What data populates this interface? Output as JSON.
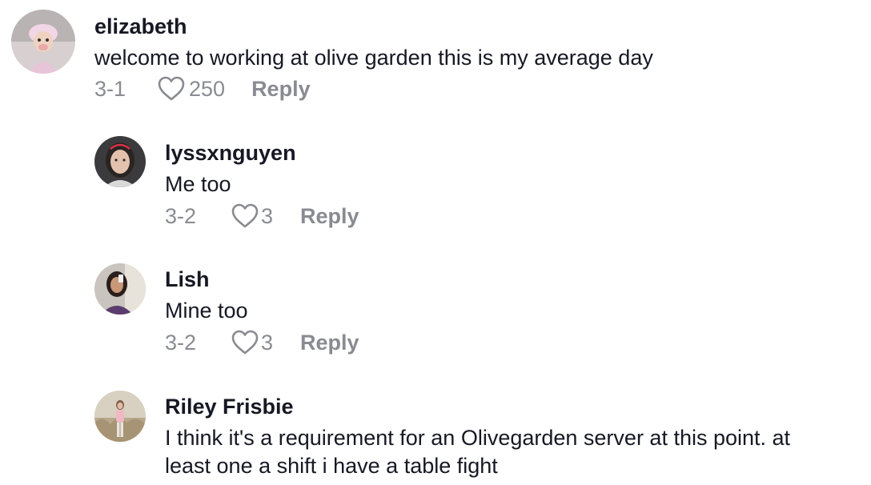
{
  "comments": [
    {
      "username": "elizabeth",
      "text_lines": [
        "welcome to working at olive garden this is my average day"
      ],
      "date": "3-1",
      "likes": "250",
      "reply_label": "Reply"
    },
    {
      "username": "lyssxnguyen",
      "text_lines": [
        "Me too"
      ],
      "date": "3-2",
      "likes": "3",
      "reply_label": "Reply"
    },
    {
      "username": "Lish",
      "text_lines": [
        "Mine too"
      ],
      "date": "3-2",
      "likes": "3",
      "reply_label": "Reply"
    },
    {
      "username": "Riley Frisbie",
      "text_lines": [
        "I think it's a requirement for an Olivegarden server at this point. at",
        "least one a shift i have a table fight"
      ]
    }
  ],
  "colors": {
    "username": "#161823",
    "text": "#161823",
    "meta": "#8a8b91"
  },
  "icons": {
    "like": "heart-outline-icon"
  }
}
